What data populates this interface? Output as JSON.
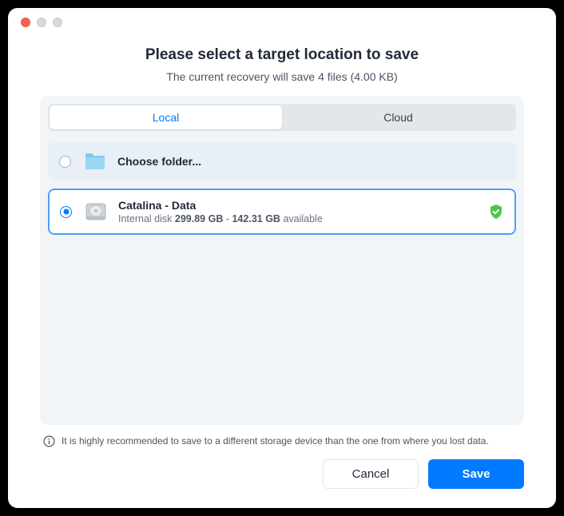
{
  "header": {
    "title": "Please select a target location to save",
    "subtitle": "The current recovery will save 4 files (4.00 KB)"
  },
  "tabs": {
    "local": "Local",
    "cloud": "Cloud"
  },
  "options": {
    "folder": {
      "title": "Choose folder..."
    },
    "disk": {
      "title": "Catalina - Data",
      "type": "Internal disk",
      "total": "299.89 GB",
      "sep": " - ",
      "free": "142.31 GB",
      "avail": " available"
    }
  },
  "warning": "It is highly recommended to save to a different storage device than the one from where you lost data.",
  "buttons": {
    "cancel": "Cancel",
    "save": "Save"
  }
}
